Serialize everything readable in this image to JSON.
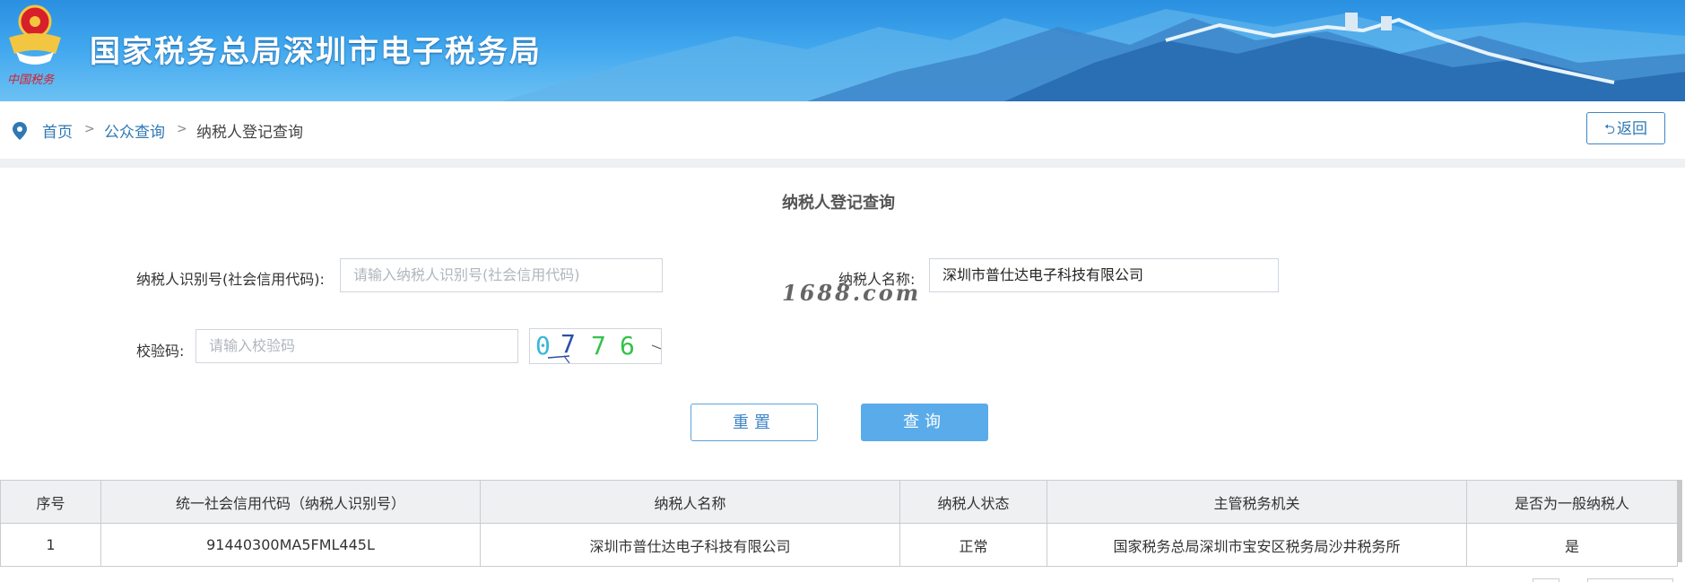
{
  "header": {
    "site_title": "国家税务总局深圳市电子税务局",
    "emblem_caption": "中国税务"
  },
  "breadcrumb": {
    "items": [
      "首页",
      "公众查询",
      "纳税人登记查询"
    ],
    "separator": ">"
  },
  "back_button": {
    "label": "返回"
  },
  "form": {
    "title": "纳税人登记查询",
    "taxpayer_id": {
      "label": "纳税人识别号(社会信用代码):",
      "placeholder": "请输入纳税人识别号(社会信用代码)",
      "value": ""
    },
    "taxpayer_name": {
      "label": "纳税人名称:",
      "value": "深圳市普仕达电子科技有限公司"
    },
    "captcha": {
      "label": "校验码:",
      "placeholder": "请输入校验码",
      "image_text": [
        "0",
        "7",
        "7",
        "6"
      ],
      "colors": [
        "#3ab7d8",
        "#2d4fa8",
        "#33c24a",
        "#33c24a"
      ]
    },
    "reset_label": "重置",
    "query_label": "查询"
  },
  "watermark": "1688.com",
  "table": {
    "columns": [
      "序号",
      "统一社会信用代码（纳税人识别号）",
      "纳税人名称",
      "纳税人状态",
      "主管税务机关",
      "是否为一般纳税人"
    ],
    "rows": [
      [
        "1",
        "91440300MA5FML445L",
        "深圳市普仕达电子科技有限公司",
        "正常",
        "国家税务总局深圳市宝安区税务局沙井税务所",
        "是"
      ]
    ]
  },
  "colors": {
    "link": "#2f78b5",
    "primary_button": "#5aabea",
    "header_blue": "#2a8fe0"
  }
}
